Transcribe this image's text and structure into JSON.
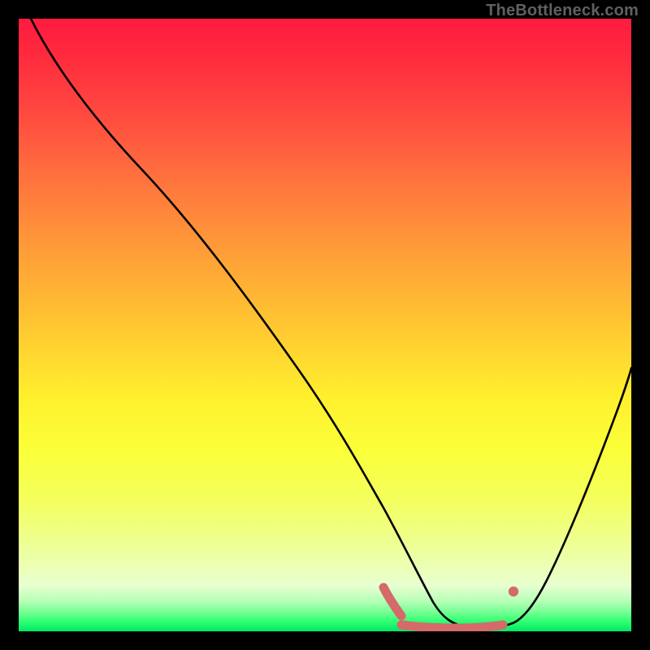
{
  "watermark": {
    "text": "TheBottleneck.com"
  },
  "chart_data": {
    "type": "line",
    "title": "",
    "subtitle": "",
    "xlabel": "",
    "ylabel": "",
    "xlim": [
      0,
      100
    ],
    "ylim": [
      0,
      100
    ],
    "legend": false,
    "grid": false,
    "background_gradient": "red-to-green vertical",
    "series": [
      {
        "name": "bottleneck-curve",
        "x": [
          2,
          8,
          14,
          20,
          26,
          32,
          38,
          44,
          50,
          55.5,
          58,
          62,
          66,
          70,
          74,
          78,
          81,
          84,
          88,
          92,
          96,
          100
        ],
        "y": [
          100,
          92,
          84,
          75.5,
          67,
          58,
          49,
          40,
          30.5,
          20.5,
          15,
          8,
          3.5,
          1.2,
          0.6,
          0.6,
          1.5,
          4,
          11,
          22,
          35,
          49
        ],
        "note": "values estimated from pixel positions; y=0 is bottom (green), y=100 is top (red)"
      }
    ],
    "markers": [
      {
        "name": "short-optimum-band",
        "x_from": 59.6,
        "x_to": 62.5,
        "y": 7.1,
        "color": "#d46a6a",
        "note": "muted red overlay segment, left"
      },
      {
        "name": "optimum-band",
        "x_from": 62.5,
        "x_to": 78.5,
        "y": 0.9,
        "color": "#d46a6a",
        "note": "muted red overlay segment along the green valley"
      },
      {
        "name": "optimum-end-dot",
        "x": 80.6,
        "y": 6.6,
        "color": "#d46a6a",
        "note": "small dot where band rejoins curve"
      }
    ],
    "colors": {
      "curve_stroke": "#000000",
      "marker_fill": "#d46a6a",
      "frame": "#000000"
    }
  }
}
